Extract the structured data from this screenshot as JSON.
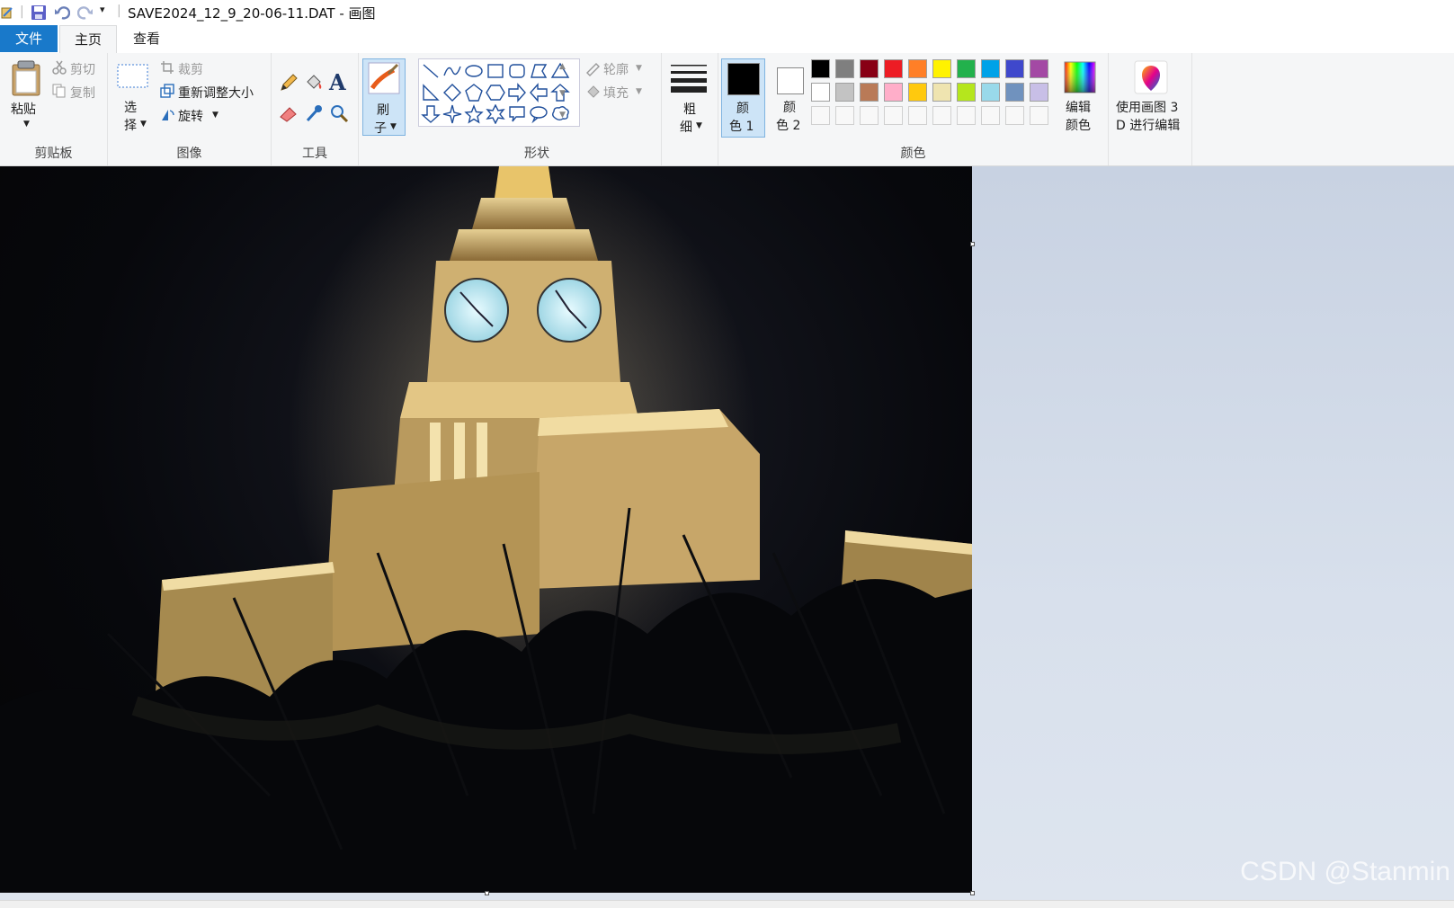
{
  "window": {
    "title": "SAVE2024_12_9_20-06-11.DAT - 画图"
  },
  "quick_access": {
    "icons": [
      "paint-app-icon",
      "save-icon",
      "undo-icon",
      "redo-icon",
      "customize-dropdown-icon"
    ]
  },
  "tabs": [
    {
      "label": "文件",
      "active": false
    },
    {
      "label": "主页",
      "active": true
    },
    {
      "label": "查看",
      "active": false
    }
  ],
  "ribbon": {
    "clipboard": {
      "group_label": "剪贴板",
      "paste": "粘贴",
      "cut": "剪切",
      "copy": "复制"
    },
    "image": {
      "group_label": "图像",
      "select_line1": "选",
      "select_line2": "择",
      "crop": "裁剪",
      "resize": "重新调整大小",
      "rotate": "旋转"
    },
    "tools": {
      "group_label": "工具",
      "tool_icons": [
        "pencil-icon",
        "fill-bucket-icon",
        "text-icon",
        "eraser-icon",
        "color-picker-icon",
        "magnifier-icon"
      ]
    },
    "brushes": {
      "line1": "刷",
      "line2": "子"
    },
    "shapes": {
      "group_label": "形状",
      "outline": "轮廓",
      "fill": "填充",
      "shape_icons": [
        "line",
        "curve",
        "oval",
        "rectangle",
        "rounded-rectangle",
        "polygon",
        "triangle",
        "right-triangle",
        "diamond",
        "pentagon",
        "hexagon",
        "right-arrow",
        "left-arrow",
        "up-arrow",
        "down-arrow",
        "four-point-star",
        "five-point-star",
        "six-point-star",
        "rounded-callout",
        "oval-callout",
        "cloud-callout"
      ]
    },
    "size": {
      "line1": "粗",
      "line2": "细"
    },
    "colors": {
      "group_label": "颜色",
      "color1_line1": "颜",
      "color1_line2": "色 1",
      "color2_line1": "颜",
      "color2_line2": "色 2",
      "color1": "#000000",
      "color2": "#ffffff",
      "edit_colors_line1": "编辑",
      "edit_colors_line2": "颜色",
      "palette_row1": [
        "#000000",
        "#7f7f7f",
        "#880015",
        "#ed1c24",
        "#ff7f27",
        "#fff200",
        "#22b14c",
        "#00a2e8",
        "#3f48cc",
        "#a349a4"
      ],
      "palette_row2": [
        "#ffffff",
        "#c3c3c3",
        "#b97a57",
        "#ffaec9",
        "#ffc90e",
        "#efe4b0",
        "#b5e61d",
        "#99d9ea",
        "#7092be",
        "#c8bfe7"
      ]
    },
    "paint3d": {
      "line1": "使用画图 3",
      "line2": "D 进行编辑"
    }
  },
  "canvas": {
    "image_description_icon": "clock-tower-night-photo"
  },
  "watermark": "CSDN @Stanmin"
}
